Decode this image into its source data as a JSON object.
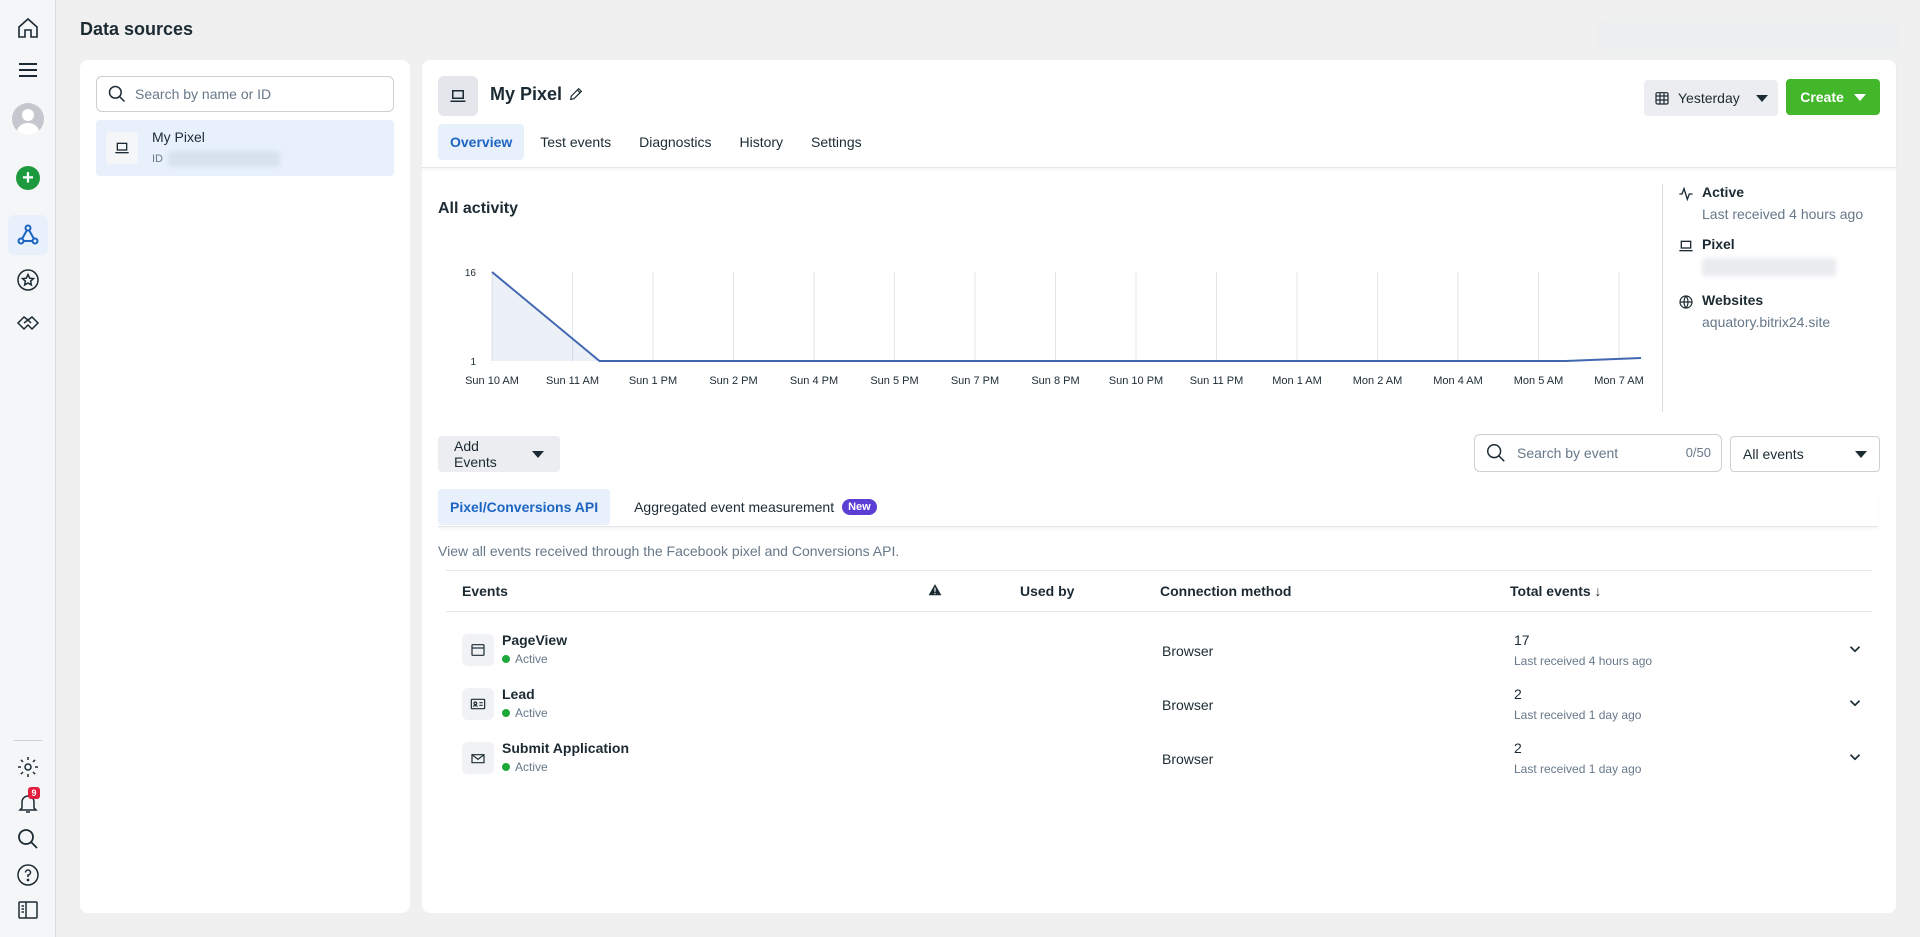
{
  "page_title": "Data sources",
  "search": {
    "placeholder": "Search by name or ID"
  },
  "sources": [
    {
      "name": "My Pixel",
      "id_label": "ID"
    }
  ],
  "rail": {
    "notification_count": "9"
  },
  "pixel": {
    "title": "My Pixel",
    "tabs": [
      "Overview",
      "Test events",
      "Diagnostics",
      "History",
      "Settings"
    ],
    "date_range": "Yesterday",
    "create_label": "Create"
  },
  "activity": {
    "title": "All activity",
    "status_label": "Active",
    "status_sub": "Last received 4 hours ago",
    "pixel_label": "Pixel",
    "websites_label": "Websites",
    "website": "aquatory.bitrix24.site"
  },
  "chart_data": {
    "type": "area",
    "title": "All activity",
    "categories": [
      "Sun 10 AM",
      "Sun 11 AM",
      "Sun 1 PM",
      "Sun 2 PM",
      "Sun 4 PM",
      "Sun 5 PM",
      "Sun 7 PM",
      "Sun 8 PM",
      "Sun 10 PM",
      "Sun 11 PM",
      "Mon 1 AM",
      "Mon 2 AM",
      "Mon 4 AM",
      "Mon 5 AM",
      "Mon 7 AM"
    ],
    "series": [
      {
        "values": [
          16,
          1,
          1,
          1,
          1,
          1,
          1,
          1,
          1,
          1,
          1,
          1,
          1,
          1,
          1.5
        ]
      }
    ],
    "y_ticks": [
      "16",
      "1"
    ],
    "ylim": [
      1,
      16
    ],
    "color": "#4267b2",
    "grid": true
  },
  "controls": {
    "add_events": "Add Events",
    "event_search_placeholder": "Search by event",
    "event_count": "0/50",
    "filter": "All events"
  },
  "subtabs": {
    "pixel_capi": "Pixel/Conversions API",
    "aggregated": "Aggregated event measurement",
    "new_badge": "New"
  },
  "description": "View all events received through the Facebook pixel and Conversions API.",
  "table": {
    "headers": {
      "events": "Events",
      "used_by": "Used by",
      "connection": "Connection method",
      "total": "Total events ↓"
    },
    "rows": [
      {
        "name": "PageView",
        "status": "Active",
        "method": "Browser",
        "total": "17",
        "last": "Last received 4 hours ago",
        "icon": "browser-window-icon"
      },
      {
        "name": "Lead",
        "status": "Active",
        "method": "Browser",
        "total": "2",
        "last": "Last received 1 day ago",
        "icon": "id-card-icon"
      },
      {
        "name": "Submit Application",
        "status": "Active",
        "method": "Browser",
        "total": "2",
        "last": "Last received 1 day ago",
        "icon": "envelope-icon"
      }
    ]
  },
  "colors": {
    "accent_blue": "#1d65c1",
    "create_green": "#42b72a",
    "new_badge": "#5b3fd4",
    "active_dot": "#1fa83a"
  }
}
